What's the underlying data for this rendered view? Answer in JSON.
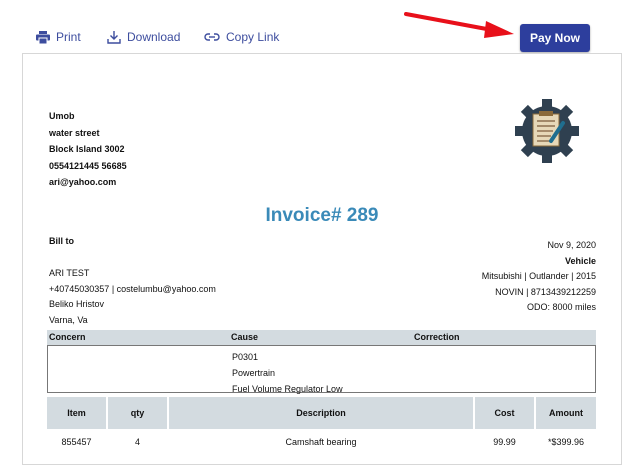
{
  "toolbar": {
    "print_label": "Print",
    "download_label": "Download",
    "copy_label": "Copy Link",
    "pay_label": "Pay Now",
    "accent_color": "#2d3e9d",
    "arrow_color": "#e8101a"
  },
  "company": {
    "name": "Umob",
    "street": "water street",
    "city": "Block Island 3002",
    "phone": "0554121445 56685",
    "email": "ari@yahoo.com"
  },
  "invoice": {
    "title": "Invoice# 289",
    "date": "Nov 9, 2020"
  },
  "bill_to": {
    "label": "Bill to",
    "name": "ARI TEST",
    "contact": "+40745030357 | costelumbu@yahoo.com",
    "person": "Beliko Hristov",
    "location": "Varna, Va"
  },
  "vehicle": {
    "label": "Vehicle",
    "model": "Mitsubishi | Outlander | 2015",
    "vin": "NOVIN | 8713439212259",
    "odo": "ODO: 8000 miles"
  },
  "concern_table": {
    "headers": [
      "Concern",
      "Cause",
      "Correction"
    ],
    "cause_lines": [
      "P0301",
      "Powertrain",
      "Fuel Volume Regulator Low"
    ]
  },
  "items_table": {
    "headers": [
      "Item",
      "qty",
      "Description",
      "Cost",
      "Amount"
    ],
    "rows": [
      {
        "item": "855457",
        "qty": "4",
        "description": "Camshaft bearing",
        "cost": "99.99",
        "amount": "*$399.96"
      }
    ]
  }
}
